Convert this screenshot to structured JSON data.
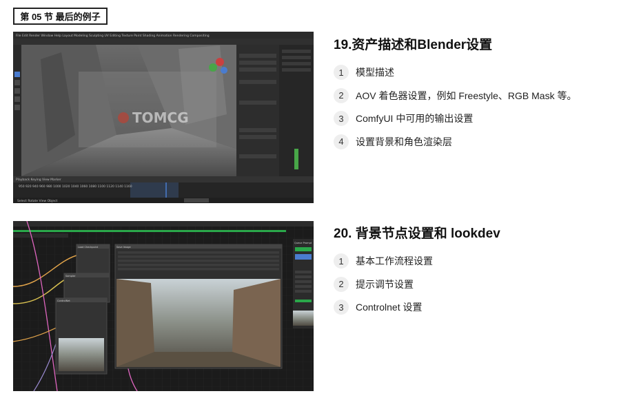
{
  "section_tag": "第 05 节 最后的例子",
  "blocks": [
    {
      "title": "19.资产描述和Blender设置",
      "items": [
        {
          "num": "1",
          "text": "模型描述"
        },
        {
          "num": "2",
          "text": "AOV 着色器设置，例如 Freestyle、RGB Mask 等。"
        },
        {
          "num": "3",
          "text": "ComfyUI 中可用的输出设置"
        },
        {
          "num": "4",
          "text": "设置背景和角色渲染层"
        }
      ]
    },
    {
      "title": "20. 背景节点设置和 lookdev",
      "items": [
        {
          "num": "1",
          "text": "基本工作流程设置"
        },
        {
          "num": "2",
          "text": "提示调节设置"
        },
        {
          "num": "3",
          "text": "Controlnet 设置"
        }
      ]
    }
  ],
  "blender_screenshot": {
    "watermark": "TOMCG",
    "menu": [
      "File",
      "Edit",
      "Render",
      "Window",
      "Help",
      "Layout",
      "Modeling",
      "Sculpting",
      "UV Editing",
      "Texture Paint",
      "Shading",
      "Animation",
      "Rendering",
      "Compositing"
    ],
    "timeline_buttons": [
      "Playback",
      "Keying",
      "View",
      "Marker"
    ],
    "status_items": [
      "Select",
      "Rotate View",
      "Object"
    ],
    "frame_numbers": [
      "950",
      "920",
      "940",
      "960",
      "980",
      "1000",
      "1020",
      "1040",
      "1060",
      "1080",
      "1100",
      "1120",
      "1140",
      "1160"
    ]
  },
  "comfy_screenshot": {
    "node_titles": [
      "Load Checkpoint",
      "Sampler",
      "ControlNet",
      "Save Image",
      "Queue Prompt"
    ]
  }
}
